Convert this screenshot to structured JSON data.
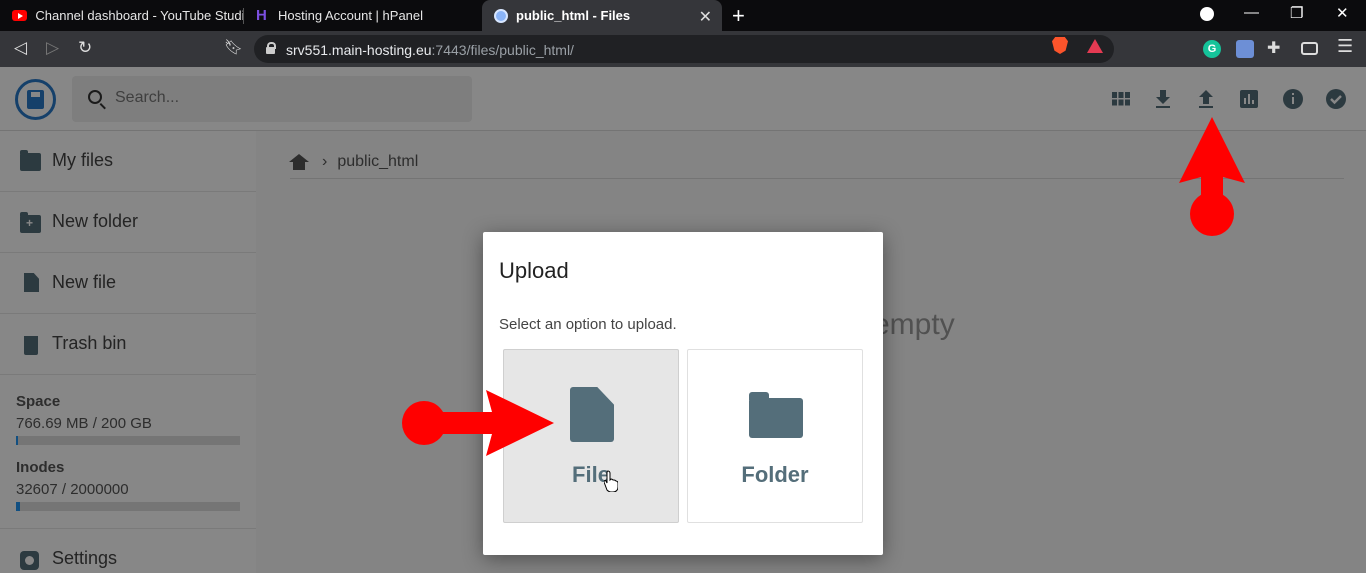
{
  "browser": {
    "tabs": [
      {
        "title": "Channel dashboard - YouTube Studio",
        "icon": "youtube-icon"
      },
      {
        "title": "Hosting Account | hPanel",
        "icon": "hostinger-icon"
      },
      {
        "title": "public_html - Files",
        "icon": "globe-icon",
        "active": true
      }
    ],
    "url_host": "srv551.main-hosting.eu",
    "url_path": ":7443/files/public_html/"
  },
  "app": {
    "search_placeholder": "Search...",
    "header_icons": [
      "grid-view-icon",
      "download-icon",
      "upload-icon",
      "stats-icon",
      "info-icon",
      "select-icon"
    ]
  },
  "sidebar": {
    "items": [
      {
        "label": "My files",
        "icon": "folder-icon"
      },
      {
        "label": "New folder",
        "icon": "new-folder-icon"
      },
      {
        "label": "New file",
        "icon": "new-file-icon"
      },
      {
        "label": "Trash bin",
        "icon": "trash-icon"
      }
    ],
    "space": {
      "title": "Space",
      "value": "766.69 MB / 200 GB",
      "fraction": 0.004
    },
    "inodes": {
      "title": "Inodes",
      "value": "32607 / 2000000",
      "fraction": 0.016
    },
    "settings_label": "Settings"
  },
  "main": {
    "breadcrumb": "public_html",
    "empty_text": "empty"
  },
  "dialog": {
    "title": "Upload",
    "subtitle": "Select an option to upload.",
    "options": [
      {
        "label": "File",
        "icon": "file-icon"
      },
      {
        "label": "Folder",
        "icon": "folder-icon"
      }
    ]
  },
  "colors": {
    "accent": "#2979c9",
    "icon_gray": "#546e7a",
    "annotation_red": "#ff0000"
  }
}
